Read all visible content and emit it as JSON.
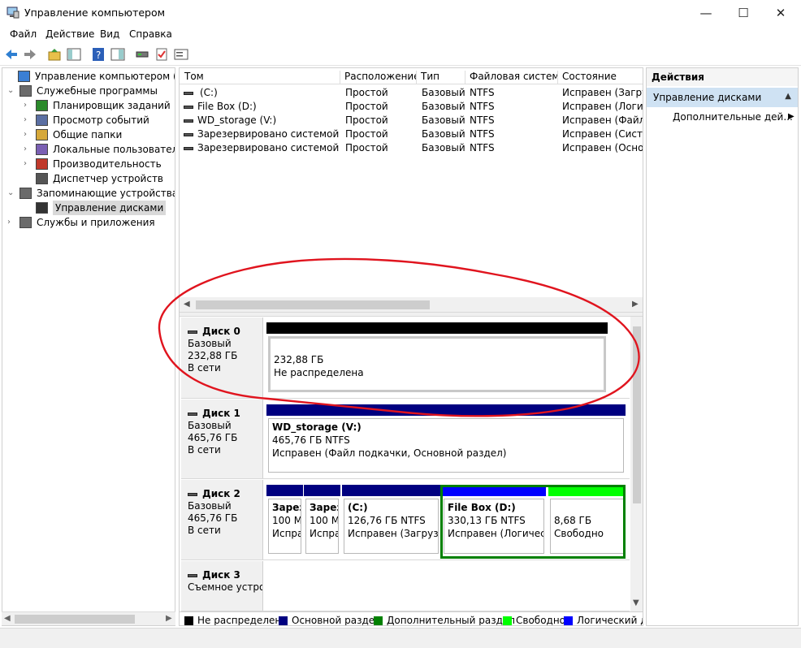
{
  "window": {
    "title": "Управление компьютером"
  },
  "menu": [
    "Файл",
    "Действие",
    "Вид",
    "Справка"
  ],
  "tree": [
    {
      "label": "Управление компьютером (локал",
      "level": 0,
      "expander": "",
      "icon": "computer-management-icon"
    },
    {
      "label": "Служебные программы",
      "level": 1,
      "expander": "⌄",
      "icon": "tools-icon"
    },
    {
      "label": "Планировщик заданий",
      "level": 2,
      "expander": "›",
      "icon": "task-scheduler-icon"
    },
    {
      "label": "Просмотр событий",
      "level": 2,
      "expander": "›",
      "icon": "event-viewer-icon"
    },
    {
      "label": "Общие папки",
      "level": 2,
      "expander": "›",
      "icon": "shared-folders-icon"
    },
    {
      "label": "Локальные пользователи и",
      "level": 2,
      "expander": "›",
      "icon": "local-users-icon"
    },
    {
      "label": "Производительность",
      "level": 2,
      "expander": "›",
      "icon": "performance-icon"
    },
    {
      "label": "Диспетчер устройств",
      "level": 2,
      "expander": "",
      "icon": "device-manager-icon"
    },
    {
      "label": "Запоминающие устройства",
      "level": 1,
      "expander": "⌄",
      "icon": "storage-icon"
    },
    {
      "label": "Управление дисками",
      "level": 2,
      "expander": "",
      "icon": "disk-management-icon",
      "selected": true
    },
    {
      "label": "Службы и приложения",
      "level": 1,
      "expander": "›",
      "icon": "services-icon"
    }
  ],
  "volumes": {
    "headers": [
      "Том",
      "Расположение",
      "Тип",
      "Файловая система",
      "Состояние"
    ],
    "rows": [
      [
        "(C:)",
        "Простой",
        "Базовый",
        "NTFS",
        "Исправен (Загрузка"
      ],
      [
        "File Box (D:)",
        "Простой",
        "Базовый",
        "NTFS",
        "Исправен (Логиче"
      ],
      [
        "WD_storage (V:)",
        "Простой",
        "Базовый",
        "NTFS",
        "Исправен (Файл п"
      ],
      [
        "Зарезервировано системой",
        "Простой",
        "Базовый",
        "NTFS",
        "Исправен (Систем"
      ],
      [
        "Зарезервировано системой (E:)",
        "Простой",
        "Базовый",
        "NTFS",
        "Исправен (Основ"
      ]
    ]
  },
  "disks": [
    {
      "name": "Диск 0",
      "type": "Базовый",
      "size": "232,88 ГБ",
      "status": "В сети",
      "partitions": [
        {
          "label": "",
          "size": "232,88 ГБ",
          "status": "Не распределена",
          "kind": "unallocated"
        }
      ]
    },
    {
      "name": "Диск 1",
      "type": "Базовый",
      "size": "465,76 ГБ",
      "status": "В сети",
      "partitions": [
        {
          "label": "WD_storage  (V:)",
          "size": "465,76 ГБ NTFS",
          "status": "Исправен (Файл подкачки, Основной раздел)",
          "kind": "primary"
        }
      ]
    },
    {
      "name": "Диск 2",
      "type": "Базовый",
      "size": "465,76 ГБ",
      "status": "В сети",
      "partitions": [
        {
          "label": "Зарез",
          "size": "100 М",
          "status": "Испра",
          "kind": "primary"
        },
        {
          "label": "Зарез",
          "size": "100 М",
          "status": "Испра",
          "kind": "primary"
        },
        {
          "label": "(C:)",
          "size": "126,76 ГБ NTFS",
          "status": "Исправен (Загрузка",
          "kind": "primary"
        },
        {
          "label": "File Box  (D:)",
          "size": "330,13 ГБ NTFS",
          "status": "Исправен (Логическ",
          "kind": "logical"
        },
        {
          "label": "",
          "size": "8,68 ГБ",
          "status": "Свободно",
          "kind": "free"
        }
      ]
    },
    {
      "name": "Диск 3",
      "type": "Съемное устро",
      "size": "",
      "status": "",
      "partitions": []
    }
  ],
  "legend": [
    {
      "label": "Не распределена",
      "color": "#000000"
    },
    {
      "label": "Основной раздел",
      "color": "#000080"
    },
    {
      "label": "Дополнительный раздел",
      "color": "#008000"
    },
    {
      "label": "Свободно",
      "color": "#00ff00"
    },
    {
      "label": "Логический ди",
      "color": "#0000ff"
    }
  ],
  "actions": {
    "header": "Действия",
    "section": "Управление дисками",
    "item": "Дополнительные дей..."
  },
  "colors": {
    "primary": "#000080",
    "logical": "#0000ff",
    "free": "#00ff00",
    "extended": "#008000",
    "unallocated": "#000000",
    "annotation": "#e0141e"
  }
}
